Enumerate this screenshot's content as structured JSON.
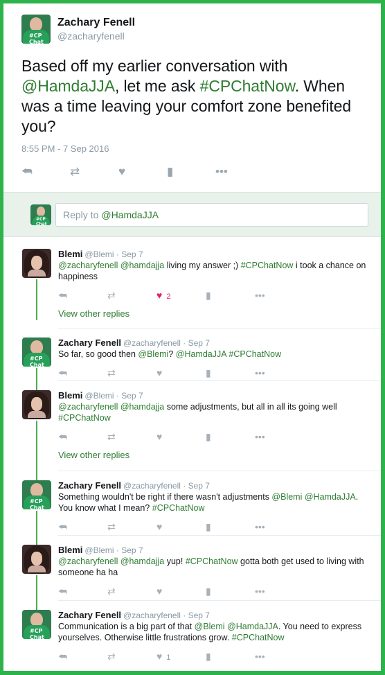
{
  "main_tweet": {
    "name": "Zachary Fenell",
    "handle": "@zacharyfenell",
    "text_parts": [
      "Based off my earlier conversation with ",
      "@HamdaJJA",
      ", let me ask ",
      "#CPChatNow",
      ". When was a time leaving your comfort zone benefited you?"
    ],
    "timestamp": "8:55 PM - 7 Sep 2016",
    "icons": [
      "reply-icon",
      "retweet-icon",
      "like-icon",
      "analytics-icon",
      "more-icon"
    ]
  },
  "reply_box": {
    "prefix": "Reply to",
    "mention": "@HamdaJJA"
  },
  "avatar_text": "#CP Chat Now",
  "thread": [
    {
      "name": "Blemi",
      "handle": "@Blemi",
      "date": "Sep 7",
      "parts": [
        [
          "link",
          "@zacharyfenell"
        ],
        [
          "text",
          " "
        ],
        [
          "link",
          "@hamdajja"
        ],
        [
          "text",
          " living my answer ;) "
        ],
        [
          "link",
          "#CPChatNow"
        ],
        [
          "text",
          " i took a chance on happiness"
        ]
      ],
      "like_count": "2",
      "liked": true,
      "view_more": "View other replies"
    },
    {
      "name": "Zachary Fenell",
      "handle": "@zacharyfenell",
      "date": "Sep 7",
      "parts": [
        [
          "text",
          "So far, so good then "
        ],
        [
          "link",
          "@Blemi"
        ],
        [
          "text",
          "? "
        ],
        [
          "link",
          "@HamdaJJA"
        ],
        [
          "text",
          " "
        ],
        [
          "link",
          "#CPChatNow"
        ]
      ],
      "like_count": "",
      "liked": false,
      "view_more": ""
    },
    {
      "name": "Blemi",
      "handle": "@Blemi",
      "date": "Sep 7",
      "parts": [
        [
          "link",
          "@zacharyfenell"
        ],
        [
          "text",
          " "
        ],
        [
          "link",
          "@hamdajja"
        ],
        [
          "text",
          " some adjustments, but all in all its going well "
        ],
        [
          "link",
          "#CPChatNow"
        ]
      ],
      "like_count": "",
      "liked": false,
      "view_more": "View other replies"
    },
    {
      "name": "Zachary Fenell",
      "handle": "@zacharyfenell",
      "date": "Sep 7",
      "parts": [
        [
          "text",
          "Something wouldn't be right if there wasn't adjustments "
        ],
        [
          "link",
          "@Blemi"
        ],
        [
          "text",
          " "
        ],
        [
          "link",
          "@HamdaJJA"
        ],
        [
          "text",
          ". You know what I mean? "
        ],
        [
          "link",
          "#CPChatNow"
        ]
      ],
      "like_count": "",
      "liked": false,
      "view_more": ""
    },
    {
      "name": "Blemi",
      "handle": "@Blemi",
      "date": "Sep 7",
      "parts": [
        [
          "link",
          "@zacharyfenell"
        ],
        [
          "text",
          " "
        ],
        [
          "link",
          "@hamdajja"
        ],
        [
          "text",
          " yup! "
        ],
        [
          "link",
          "#CPChatNow"
        ],
        [
          "text",
          " gotta both get used to living with someone ha ha"
        ]
      ],
      "like_count": "",
      "liked": false,
      "view_more": ""
    },
    {
      "name": "Zachary Fenell",
      "handle": "@zacharyfenell",
      "date": "Sep 7",
      "parts": [
        [
          "text",
          "Communication is a big part of that "
        ],
        [
          "link",
          "@Blemi"
        ],
        [
          "text",
          " "
        ],
        [
          "link",
          "@HamdaJJA"
        ],
        [
          "text",
          ". You need to express yourselves. Otherwise little frustrations grow. "
        ],
        [
          "link",
          "#CPChatNow"
        ]
      ],
      "like_count": "1",
      "liked": false,
      "view_more": ""
    }
  ]
}
